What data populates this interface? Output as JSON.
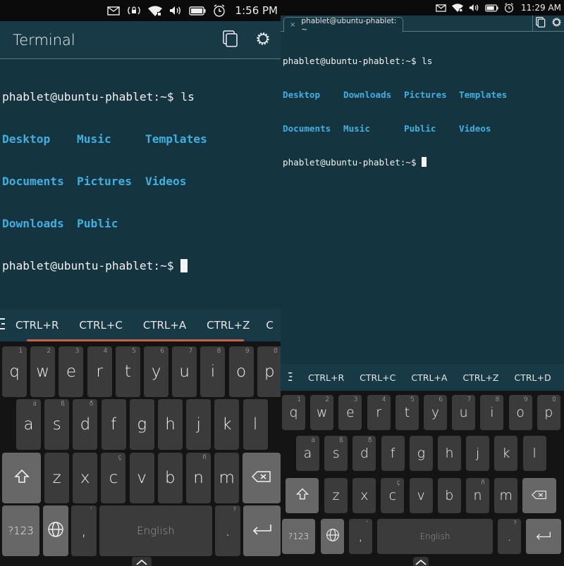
{
  "left": {
    "status": {
      "icons": [
        "envelope-icon",
        "rotation-lock-icon",
        "wifi-icon",
        "volume-icon",
        "battery-icon",
        "alarm-icon"
      ],
      "time": "1:56 PM"
    },
    "header": {
      "title": "Terminal",
      "buttons": [
        "tabs-icon",
        "settings-gear-icon"
      ]
    },
    "terminal": {
      "prompt": "phablet@ubuntu-phablet:~$ ",
      "command": "ls",
      "rows": [
        [
          "Desktop",
          "Music",
          "Templates"
        ],
        [
          "Documents",
          "Pictures",
          "Videos"
        ],
        [
          "Downloads",
          "Public",
          ""
        ]
      ]
    },
    "ctrl_keys": [
      "CTRL+R",
      "CTRL+C",
      "CTRL+A",
      "CTRL+Z",
      "C"
    ]
  },
  "right": {
    "status": {
      "icons": [
        "envelope-icon",
        "wifi-icon",
        "volume-icon",
        "battery-icon",
        "alarm-icon"
      ],
      "time": "11:29 AM"
    },
    "tab": {
      "close": "×",
      "title": "phablet@ubuntu-phablet: ~"
    },
    "terminal": {
      "prompt": "phablet@ubuntu-phablet:~$ ",
      "command": "ls",
      "rows": [
        [
          "Desktop",
          "Downloads",
          "Pictures",
          "Templates"
        ],
        [
          "Documents",
          "Music",
          "Public",
          "Videos"
        ]
      ]
    },
    "ctrl_keys": [
      "CTRL+R",
      "CTRL+C",
      "CTRL+A",
      "CTRL+Z",
      "CTRL+D"
    ]
  },
  "keyboard": {
    "row1": [
      {
        "k": "q",
        "s": "1"
      },
      {
        "k": "w",
        "s": "2"
      },
      {
        "k": "e",
        "s": "3"
      },
      {
        "k": "r",
        "s": "4"
      },
      {
        "k": "t",
        "s": "5"
      },
      {
        "k": "y",
        "s": "6"
      },
      {
        "k": "u",
        "s": "7"
      },
      {
        "k": "i",
        "s": "8"
      },
      {
        "k": "o",
        "s": "9"
      },
      {
        "k": "p",
        "s": "0"
      }
    ],
    "row2": [
      {
        "k": "a",
        "s": "ä"
      },
      {
        "k": "s",
        "s": "ß"
      },
      {
        "k": "d",
        "s": "ð"
      },
      {
        "k": "f",
        "s": ""
      },
      {
        "k": "g",
        "s": ""
      },
      {
        "k": "h",
        "s": ""
      },
      {
        "k": "j",
        "s": ""
      },
      {
        "k": "k",
        "s": ""
      },
      {
        "k": "l",
        "s": ""
      }
    ],
    "row3": [
      {
        "k": "z",
        "s": ""
      },
      {
        "k": "x",
        "s": ""
      },
      {
        "k": "c",
        "s": "ç"
      },
      {
        "k": "v",
        "s": ""
      },
      {
        "k": "b",
        "s": ""
      },
      {
        "k": "n",
        "s": "ñ"
      },
      {
        "k": "m",
        "s": ""
      }
    ],
    "symbols_label": "?123",
    "comma": ",",
    "comma_sup": "'",
    "space_label": "English",
    "period": ".",
    "period_sup": "?"
  }
}
